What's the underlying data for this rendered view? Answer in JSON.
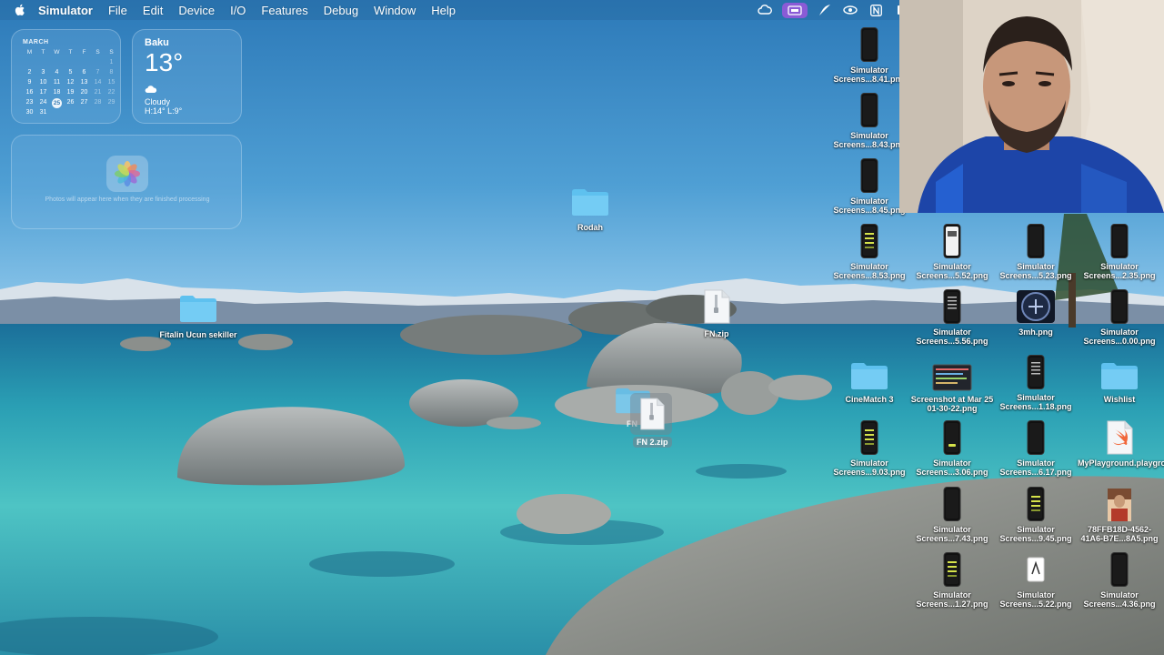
{
  "menubar": {
    "app_name": "Simulator",
    "items": [
      "File",
      "Edit",
      "Device",
      "I/O",
      "Features",
      "Debug",
      "Window",
      "Help"
    ],
    "status_icons": [
      "creative-cloud-icon",
      "screen-mirroring-icon",
      "feather-icon",
      "eye-icon",
      "notion-icon",
      "battery-icon"
    ]
  },
  "calendar": {
    "month": "MARCH",
    "weekdays": [
      "M",
      "T",
      "W",
      "T",
      "F",
      "S",
      "S"
    ],
    "rows": [
      [
        "",
        "",
        "",
        "",
        "",
        "",
        "1"
      ],
      [
        "2",
        "3",
        "4",
        "5",
        "6",
        "7",
        "8"
      ],
      [
        "9",
        "10",
        "11",
        "12",
        "13",
        "14",
        "15"
      ],
      [
        "16",
        "17",
        "18",
        "19",
        "20",
        "21",
        "22"
      ],
      [
        "23",
        "24",
        "25",
        "26",
        "27",
        "28",
        "29"
      ],
      [
        "30",
        "31",
        "",
        "",
        "",
        "",
        ""
      ]
    ],
    "today": "25"
  },
  "weather": {
    "city": "Baku",
    "temperature": "13°",
    "condition": "Cloudy",
    "high_low": "H:14° L:9°"
  },
  "photos_widget": {
    "message": "Photos will appear here when they are finished processing"
  },
  "desktop": {
    "rodah": "Rodah",
    "fitalin": "Fitalin Ucun sekiller",
    "fn_zip": "FN.zip",
    "fn2_zip": "FN 2.zip",
    "fn_partial": "FN",
    "sim_841": "Simulator Screens...8.41.png",
    "sim_843": "Simulator Screens...8.43.png",
    "sim_845": "Simulator Screens...8.45.png",
    "sim_853": "Simulator Screens...8.53.png",
    "sim_552": "Simulator Screens...5.52.png",
    "sim_523": "Simulator Screens...5.23.png",
    "sim_235": "Simulator Screens...2.35.png",
    "sim_556": "Simulator Screens...5.56.png",
    "mnh": "3mh.png",
    "sim_000": "Simulator Screens...0.00.png",
    "cinematch": "CineMatch 3",
    "screenshot": "Screenshot at Mar 25 01-30-22.png",
    "sim_118": "Simulator Screens...1.18.png",
    "wishlist": "Wishlist",
    "sim_903": "Simulator Screens...9.03.png",
    "sim_306": "Simulator Screens...3.06.png",
    "sim_617": "Simulator Screens...6.17.png",
    "playground": "MyPlayground.playground",
    "sim_743": "Simulator Screens...7.43.png",
    "sim_945": "Simulator Screens...9.45.png",
    "guid_png": "78FFB18D-4562-41A6-B7E...8A5.png",
    "sim_127": "Simulator Screens...1.27.png",
    "sim_522": "Simulator Screens...5.22.png",
    "sim_436": "Simulator Screens...4.36.png"
  },
  "colors": {
    "sky": "#2f86c4",
    "water": "#3fb3c0",
    "folder": "#5ec1ef",
    "menu_active": "#8a5bd6"
  }
}
